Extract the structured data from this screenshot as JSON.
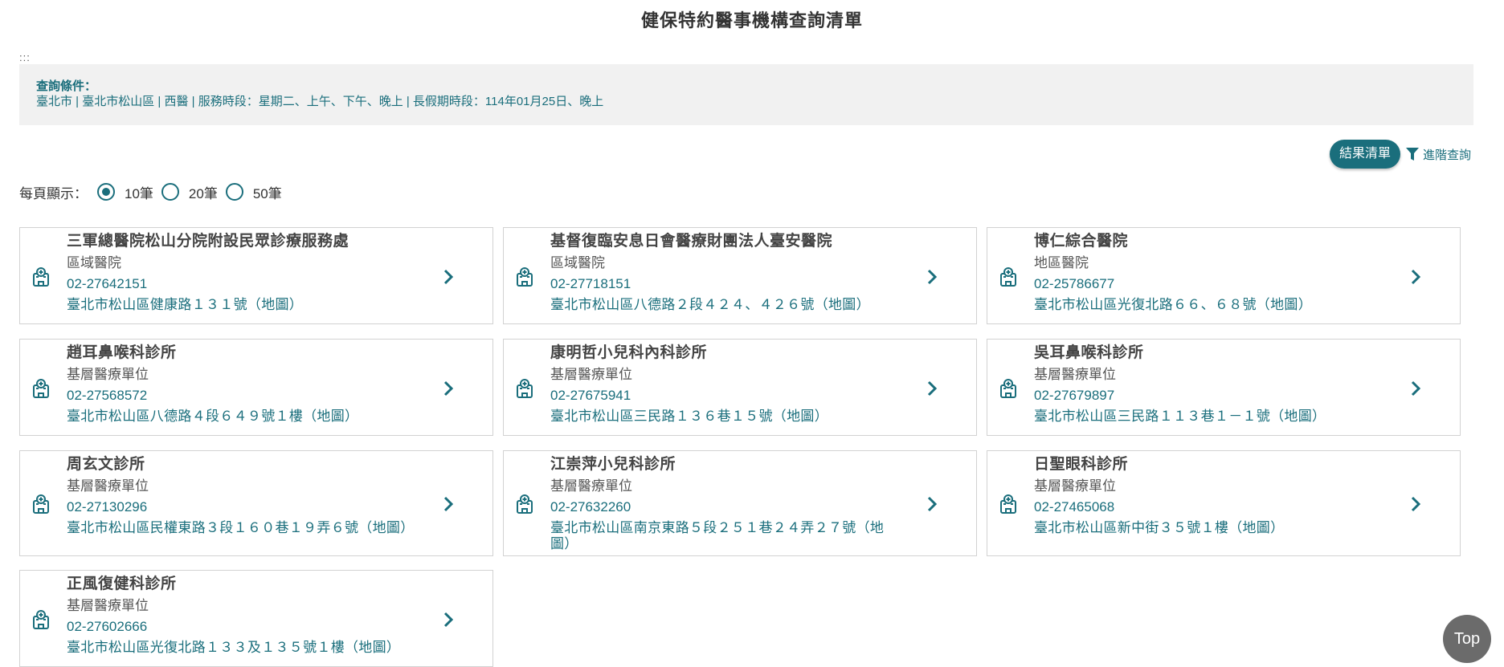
{
  "page": {
    "title": "健保特約醫事機構查詢清單",
    "skip_link": ":::"
  },
  "criteria": {
    "label": "查詢條件：",
    "text": "臺北市 | 臺北市松山區 | 西醫 | 服務時段：星期二、上午、下午、晚上 | 長假期時段：114年01月25日、晚上"
  },
  "toolbar": {
    "results_label": "結果清單",
    "advanced_label": "進階查詢"
  },
  "per_page": {
    "label": "每頁顯示：",
    "options": [
      {
        "label": "10筆",
        "checked": true
      },
      {
        "label": "20筆",
        "checked": false
      },
      {
        "label": "50筆",
        "checked": false
      }
    ]
  },
  "colors": {
    "accent": "#1a6e7c",
    "criteria_bg": "#f1f1f1",
    "top_button": "#6b6b6b"
  },
  "results": [
    {
      "name": "三軍總醫院松山分院附設民眾診療服務處",
      "type": "區域醫院",
      "phone": "02-27642151",
      "address": "臺北市松山區健康路１３１號（地圖）"
    },
    {
      "name": "基督復臨安息日會醫療財團法人臺安醫院",
      "type": "區域醫院",
      "phone": "02-27718151",
      "address": "臺北市松山區八德路２段４２４、４２６號（地圖）"
    },
    {
      "name": "博仁綜合醫院",
      "type": "地區醫院",
      "phone": "02-25786677",
      "address": "臺北市松山區光復北路６６、６８號（地圖）"
    },
    {
      "name": "趙耳鼻喉科診所",
      "type": "基層醫療單位",
      "phone": "02-27568572",
      "address": "臺北市松山區八德路４段６４９號１樓（地圖）"
    },
    {
      "name": "康明哲小兒科內科診所",
      "type": "基層醫療單位",
      "phone": "02-27675941",
      "address": "臺北市松山區三民路１３６巷１５號（地圖）"
    },
    {
      "name": "吳耳鼻喉科診所",
      "type": "基層醫療單位",
      "phone": "02-27679897",
      "address": "臺北市松山區三民路１１３巷１－１號（地圖）"
    },
    {
      "name": "周玄文診所",
      "type": "基層醫療單位",
      "phone": "02-27130296",
      "address": "臺北市松山區民權東路３段１６０巷１９弄６號（地圖）"
    },
    {
      "name": "江崇萍小兒科診所",
      "type": "基層醫療單位",
      "phone": "02-27632260",
      "address": "臺北市松山區南京東路５段２５１巷２４弄２７號（地圖）"
    },
    {
      "name": "日聖眼科診所",
      "type": "基層醫療單位",
      "phone": "02-27465068",
      "address": "臺北市松山區新中街３５號１樓（地圖）"
    },
    {
      "name": "正風復健科診所",
      "type": "基層醫療單位",
      "phone": "02-27602666",
      "address": "臺北市松山區光復北路１３３及１３５號１樓（地圖）"
    }
  ],
  "top_button": {
    "label": "Top"
  }
}
